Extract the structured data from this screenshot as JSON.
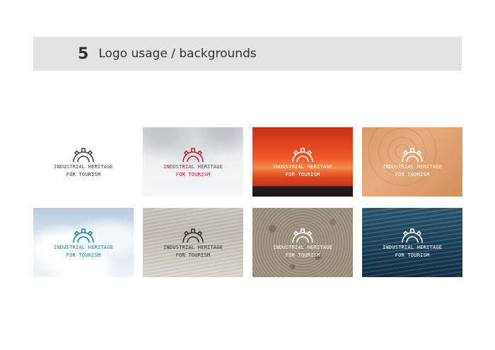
{
  "section": {
    "number": "5",
    "title": "Logo usage / backgrounds"
  },
  "logo": {
    "line1": "INDUSTRIAL HERITAGE",
    "line2": "FOR TOURISM"
  },
  "tiles": [
    {
      "background": "white",
      "logo_color": "#444444"
    },
    {
      "background": "snow",
      "logo_color": "#c8232c"
    },
    {
      "background": "sunset",
      "logo_color": "#ffffff"
    },
    {
      "background": "wood",
      "logo_color": "#ffffff"
    },
    {
      "background": "clouds",
      "logo_color": "#1a8aa0"
    },
    {
      "background": "water",
      "logo_color": "#333333"
    },
    {
      "background": "gravel",
      "logo_color": "#ffffff"
    },
    {
      "background": "sea",
      "logo_color": "#ffffff"
    }
  ]
}
